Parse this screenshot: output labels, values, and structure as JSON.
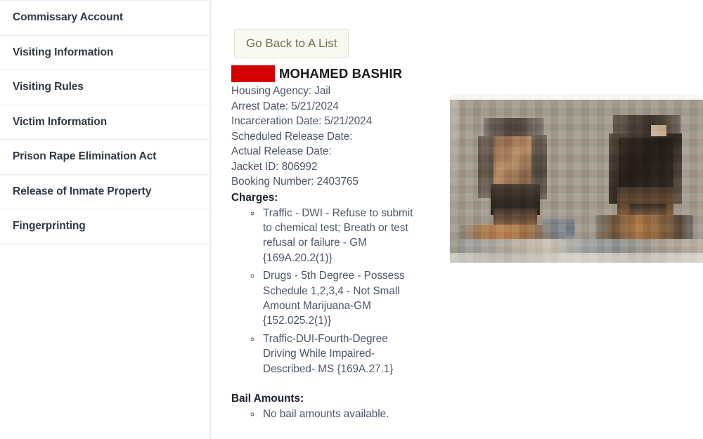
{
  "sidebar": {
    "items": [
      {
        "label": "Commissary Account"
      },
      {
        "label": "Visiting Information"
      },
      {
        "label": "Visiting Rules"
      },
      {
        "label": "Victim Information"
      },
      {
        "label": "Prison Rape Elimination Act"
      },
      {
        "label": "Release of Inmate Property"
      },
      {
        "label": "Fingerprinting"
      }
    ]
  },
  "main": {
    "back_button_label": "Go Back to A List",
    "inmate": {
      "name": "MOHAMED BASHIR",
      "redaction_color": "#d50000",
      "details": [
        "Housing Agency: Jail",
        "Arrest Date: 5/21/2024",
        "Incarceration Date: 5/21/2024",
        "Scheduled Release Date:",
        "Actual Release Date:",
        "Jacket ID: 806992",
        "Booking Number: 2403765"
      ],
      "charges_heading": "Charges:",
      "charges": [
        "Traffic - DWI - Refuse to submit to chemical test; Breath or test refusal or failure - GM {169A.20.2(1)}",
        "Drugs - 5th Degree - Possess Schedule 1,2,3,4 - Not Small Amount Marijuana-GM {152.025.2(1)}",
        "Traffic-DUI-Fourth-Degree Driving While Impaired-Described- MS {169A.27.1}"
      ],
      "bail_heading": "Bail Amounts:",
      "bail_amounts": [
        "No bail amounts available."
      ]
    },
    "mugshot": {
      "alt": "inmate-mugshot-two-views-pixelated"
    }
  }
}
